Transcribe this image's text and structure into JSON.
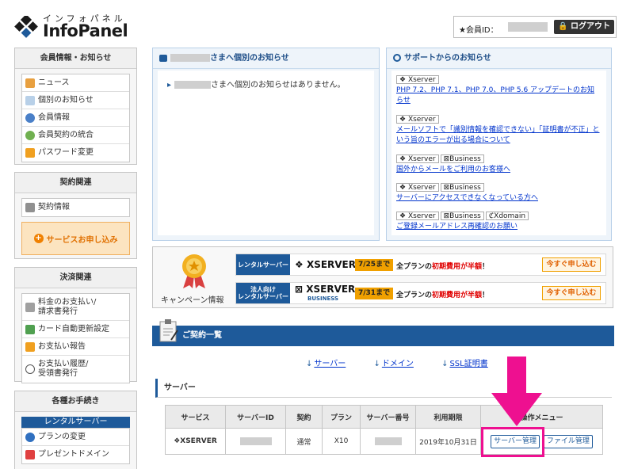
{
  "header": {
    "logo_sub": "インフォパネル",
    "logo_main": "InfoPanel",
    "member_label": "★会員ID：",
    "logout": "ログアウト"
  },
  "sidebar": {
    "member_section": {
      "title": "会員情報・お知らせ",
      "items": [
        "ニュース",
        "個別のお知らせ",
        "会員情報",
        "会員契約の統合",
        "パスワード変更"
      ]
    },
    "contract_section": {
      "title": "契約関連",
      "items": [
        "契約情報"
      ],
      "apply_button": "サービスお申し込み"
    },
    "payment_section": {
      "title": "決済関連",
      "items": [
        "料金のお支払い/\n請求書発行",
        "カード自動更新設定",
        "お支払い報告",
        "お支払い履歴/\n受領書発行"
      ]
    },
    "procedures_section": {
      "title": "各種お手続き",
      "rental_header": "レンタルサーバー",
      "items": [
        "プランの変更",
        "プレゼントドメイン"
      ]
    }
  },
  "personal_notice": {
    "title": "さまへ個別のお知らせ",
    "message": "さまへ個別のお知らせはありません。"
  },
  "support_notice": {
    "title": "サポートからのお知らせ",
    "items": [
      {
        "tags": [
          "Xserver"
        ],
        "text": "PHP 7.2、PHP 7.1、PHP 7.0、PHP 5.6 アップデートのお知らせ"
      },
      {
        "tags": [
          "Xserver"
        ],
        "text": "メールソフトで「識別情報を確認できない」「証明書が不正」という旨のエラーが出る場合について"
      },
      {
        "tags": [
          "Xserver",
          "Business"
        ],
        "text": "国外からメールをご利用のお客様へ"
      },
      {
        "tags": [
          "Xserver",
          "Business"
        ],
        "text": "サーバーにアクセスできなくなっている方へ"
      },
      {
        "tags": [
          "Xserver",
          "Business",
          "Xdomain"
        ],
        "text": "ご登録メールアドレス再確認のお願い"
      }
    ]
  },
  "campaign": {
    "label": "キャンペーン情報",
    "rows": [
      {
        "type": "レンタルサーバー",
        "brand": "XSERVER",
        "brand_sub": "",
        "date": "7/25まで",
        "msg_pre": "全プランの",
        "msg_hl": "初期費用が半額",
        "msg_post": "！",
        "button": "今すぐ申し込む"
      },
      {
        "type": "法人向け\nレンタルサーバー",
        "brand": "XSERVER",
        "brand_sub": "BUSINESS",
        "date": "7/31まで",
        "msg_pre": "全プランの",
        "msg_hl": "初期費用が半額",
        "msg_post": "！",
        "button": "今すぐ申し込む"
      }
    ]
  },
  "contracts": {
    "title": "ご契約一覧",
    "anchors": [
      "サーバー",
      "ドメイン",
      "SSL証明書"
    ],
    "server_subtitle": "サーバー",
    "table": {
      "headers": [
        "サービス",
        "サーバーID",
        "契約",
        "プラン",
        "サーバー番号",
        "利用期限",
        "操作メニュー"
      ],
      "row": {
        "service": "XSERVER",
        "contract": "通常",
        "plan": "X10",
        "expiry": "2019年10月31日",
        "btn_manage": "サーバー管理",
        "btn_file": "ファイル管理"
      }
    }
  },
  "colors": {
    "brand_blue": "#1e5a9a",
    "highlight_pink": "#ee1090",
    "accent_orange": "#f08000"
  }
}
